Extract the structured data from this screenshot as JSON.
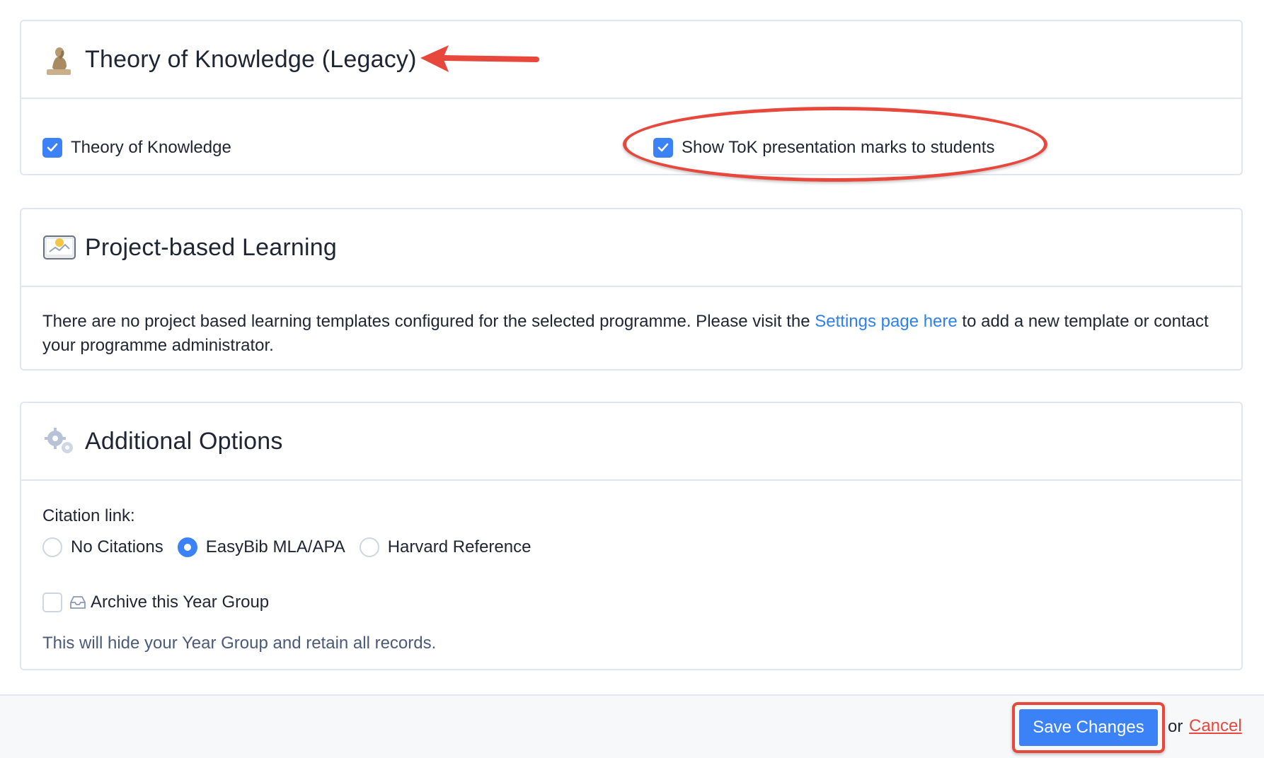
{
  "sections": {
    "tok": {
      "title": "Theory of Knowledge (Legacy)",
      "icon": "thinker-statue-icon",
      "checkbox_main": {
        "label": "Theory of Knowledge",
        "checked": true
      },
      "checkbox_marks": {
        "label": "Show ToK presentation marks to students",
        "checked": true
      }
    },
    "pbl": {
      "title": "Project-based Learning",
      "icon": "presentation-board-icon",
      "text_before": "There are no project based learning templates configured for the selected programme. Please visit the ",
      "link_text": "Settings page here",
      "text_after": " to add a new template or contact your programme administrator."
    },
    "additional": {
      "title": "Additional Options",
      "icon": "gears-icon",
      "citation_label": "Citation link:",
      "citation_options": [
        {
          "label": "No Citations",
          "selected": false
        },
        {
          "label": "EasyBib MLA/APA",
          "selected": true
        },
        {
          "label": "Harvard Reference",
          "selected": false
        }
      ],
      "archive_label": "Archive this Year Group",
      "archive_checked": false,
      "archive_help": "This will hide your Year Group and retain all records."
    }
  },
  "footer": {
    "save_label": "Save Changes",
    "or_text": "or",
    "cancel_label": "Cancel"
  },
  "colors": {
    "accent": "#3b82f6",
    "annotation": "#e8473c",
    "link": "#2f80ed",
    "muted_text": "#4a5a7a"
  }
}
